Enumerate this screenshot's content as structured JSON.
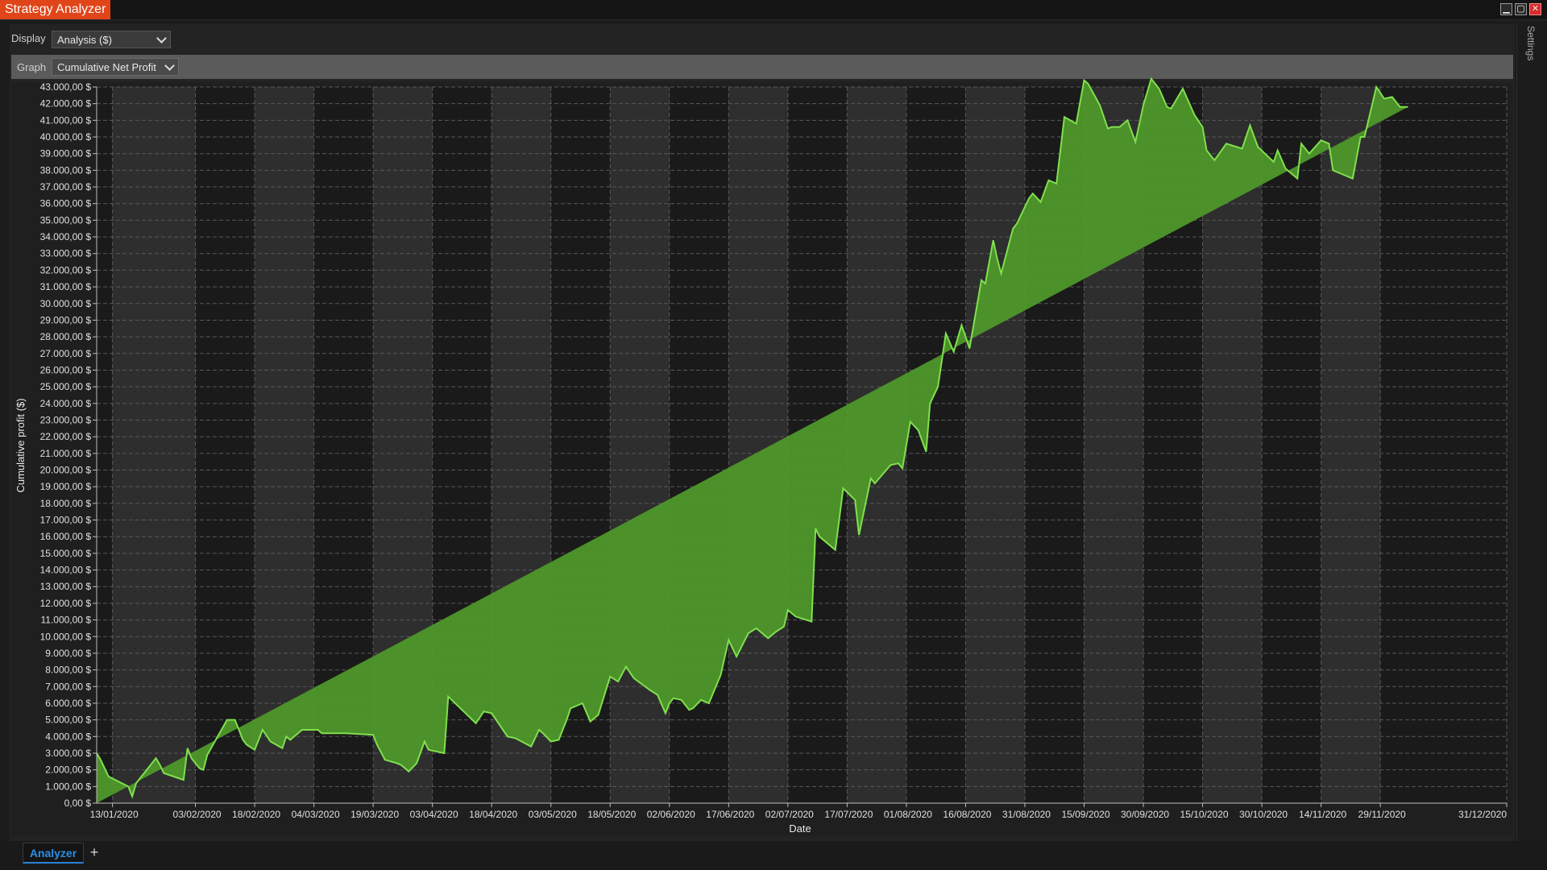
{
  "window": {
    "title": "Strategy Analyzer",
    "minimize_icon": "minimize-icon",
    "maximize_icon": "maximize-icon",
    "close_icon": "close-icon",
    "title_color": "#e0451a"
  },
  "toolbar": {
    "display_label": "Display",
    "display_value": "Analysis ($)",
    "graph_label": "Graph",
    "graph_value": "Cumulative Net Profit"
  },
  "sidebar": {
    "settings_label": "Settings"
  },
  "tabs": {
    "analyzer_label": "Analyzer",
    "add_label": "+"
  },
  "chart_data": {
    "type": "area",
    "xlabel": "Date",
    "ylabel": "Cumulative profit ($)",
    "y_tick_suffix": " $",
    "ylim": [
      0,
      43000
    ],
    "y_tick_step": 1000,
    "xlim": [
      "2020-01-09",
      "2020-12-31"
    ],
    "x_ticks": [
      "13/01/2020",
      "03/02/2020",
      "18/02/2020",
      "04/03/2020",
      "19/03/2020",
      "03/04/2020",
      "18/04/2020",
      "03/05/2020",
      "18/05/2020",
      "02/06/2020",
      "17/06/2020",
      "02/07/2020",
      "17/07/2020",
      "01/08/2020",
      "16/08/2020",
      "31/08/2020",
      "15/09/2020",
      "30/09/2020",
      "15/10/2020",
      "30/10/2020",
      "14/11/2020",
      "29/11/2020",
      "31/12/2020"
    ],
    "grid": true,
    "fill_color": "#4f9a2a",
    "line_color": "#7fe04d",
    "x": [
      "2020-01-09",
      "2020-01-10",
      "2020-01-12",
      "2020-01-17",
      "2020-01-18",
      "2020-01-19",
      "2020-01-24",
      "2020-01-25",
      "2020-01-26",
      "2020-01-31",
      "2020-02-01",
      "2020-02-02",
      "2020-02-04",
      "2020-02-05",
      "2020-02-06",
      "2020-02-11",
      "2020-02-13",
      "2020-02-15",
      "2020-02-16",
      "2020-02-18",
      "2020-02-20",
      "2020-02-22",
      "2020-02-25",
      "2020-02-26",
      "2020-02-27",
      "2020-03-01",
      "2020-03-03",
      "2020-03-04",
      "2020-03-05",
      "2020-03-06",
      "2020-03-11",
      "2020-03-12",
      "2020-03-19",
      "2020-03-20",
      "2020-03-22",
      "2020-03-25",
      "2020-03-26",
      "2020-03-28",
      "2020-03-30",
      "2020-04-01",
      "2020-04-02",
      "2020-04-06",
      "2020-04-07",
      "2020-04-14",
      "2020-04-16",
      "2020-04-18",
      "2020-04-20",
      "2020-04-22",
      "2020-04-24",
      "2020-04-28",
      "2020-04-30",
      "2020-05-01",
      "2020-05-03",
      "2020-05-05",
      "2020-05-07",
      "2020-05-08",
      "2020-05-11",
      "2020-05-13",
      "2020-05-15",
      "2020-05-18",
      "2020-05-20",
      "2020-05-22",
      "2020-05-24",
      "2020-05-28",
      "2020-05-30",
      "2020-06-01",
      "2020-06-02",
      "2020-06-03",
      "2020-06-05",
      "2020-06-07",
      "2020-06-08",
      "2020-06-10",
      "2020-06-12",
      "2020-06-15",
      "2020-06-17",
      "2020-06-19",
      "2020-06-22",
      "2020-06-24",
      "2020-06-27",
      "2020-06-29",
      "2020-07-01",
      "2020-07-02",
      "2020-07-04",
      "2020-07-08",
      "2020-07-09",
      "2020-07-10",
      "2020-07-11",
      "2020-07-14",
      "2020-07-16",
      "2020-07-19",
      "2020-07-20",
      "2020-07-23",
      "2020-07-24",
      "2020-07-28",
      "2020-07-30",
      "2020-07-31",
      "2020-08-02",
      "2020-08-04",
      "2020-08-06",
      "2020-08-07",
      "2020-08-09",
      "2020-08-11",
      "2020-08-13",
      "2020-08-15",
      "2020-08-17",
      "2020-08-20",
      "2020-08-21",
      "2020-08-23",
      "2020-08-24",
      "2020-08-25",
      "2020-08-28",
      "2020-08-29",
      "2020-08-31",
      "2020-09-01",
      "2020-09-02",
      "2020-09-04",
      "2020-09-06",
      "2020-09-08",
      "2020-09-10",
      "2020-09-13",
      "2020-09-15",
      "2020-09-16",
      "2020-09-19",
      "2020-09-21",
      "2020-09-22",
      "2020-09-24",
      "2020-09-26",
      "2020-09-28",
      "2020-09-30",
      "2020-10-02",
      "2020-10-04",
      "2020-10-06",
      "2020-10-07",
      "2020-10-08",
      "2020-10-10",
      "2020-10-13",
      "2020-10-15",
      "2020-10-16",
      "2020-10-18",
      "2020-10-21",
      "2020-10-25",
      "2020-10-27",
      "2020-10-29",
      "2020-11-02",
      "2020-11-03",
      "2020-11-05",
      "2020-11-08",
      "2020-11-09",
      "2020-11-11",
      "2020-11-14",
      "2020-11-16",
      "2020-11-17",
      "2020-11-19",
      "2020-11-22",
      "2020-11-24",
      "2020-11-25",
      "2020-11-28",
      "2020-11-30",
      "2020-12-02",
      "2020-12-04",
      "2020-12-06",
      "2020-12-07",
      "2020-12-12",
      "2020-12-13",
      "2020-12-16",
      "2020-12-18",
      "2020-12-21",
      "2020-12-31"
    ],
    "values": [
      3000,
      2600,
      1600,
      1000,
      400,
      1200,
      2700,
      2300,
      1800,
      1400,
      3300,
      2700,
      2100,
      2000,
      2900,
      5000,
      5000,
      3800,
      3500,
      3200,
      4400,
      3700,
      3300,
      4000,
      3800,
      4400,
      4400,
      4400,
      4400,
      4200,
      4200,
      4200,
      4100,
      3500,
      2600,
      2400,
      2300,
      1900,
      2400,
      3700,
      3200,
      3000,
      6400,
      4800,
      5500,
      5400,
      4700,
      4000,
      3900,
      3400,
      4400,
      4200,
      3700,
      3800,
      5000,
      5700,
      6000,
      4900,
      5300,
      7600,
      7300,
      8200,
      7500,
      6800,
      6500,
      5400,
      6000,
      6300,
      6200,
      5600,
      5700,
      6200,
      6000,
      7700,
      9800,
      8800,
      10200,
      10500,
      9900,
      10300,
      10600,
      11600,
      11200,
      10900,
      16500,
      16000,
      15800,
      15200,
      18900,
      18200,
      16100,
      19500,
      19200,
      20300,
      20400,
      20100,
      22900,
      22400,
      21100,
      24000,
      25000,
      28200,
      27100,
      28700,
      27300,
      31400,
      31200,
      33800,
      32700,
      31800,
      34500,
      34800,
      35800,
      36300,
      36600,
      36100,
      37400,
      37200,
      41200,
      40800,
      43400,
      43200,
      41900,
      40500,
      40600,
      40600,
      41000,
      39700,
      41900,
      43500,
      42900,
      41800,
      41700,
      42100,
      42900,
      41300,
      40600,
      39200,
      38600,
      39600,
      39300,
      40700,
      39400,
      38500,
      39200,
      38100,
      37500,
      39600,
      39000,
      39800,
      39600,
      38000,
      37800,
      37500,
      40000,
      40000,
      43000,
      42300,
      42400,
      41800,
      41800
    ]
  }
}
